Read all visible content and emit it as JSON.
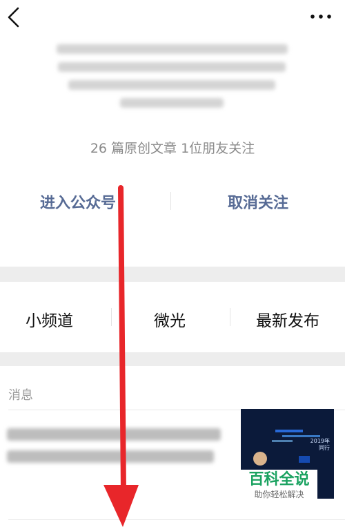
{
  "header": {
    "back_icon": "chevron-left-icon",
    "more_icon": "more-dots-icon"
  },
  "profile": {
    "stats": "26 篇原创文章 1位朋友关注"
  },
  "actions": {
    "enter": "进入公众号",
    "unfollow": "取消关注",
    "accent_color": "#576b95"
  },
  "tabs": [
    {
      "label": "小频道"
    },
    {
      "label": "微光"
    },
    {
      "label": "最新发布"
    }
  ],
  "messages": {
    "section_label": "消息",
    "thumbnail_caption": "2019年\n同行"
  },
  "watermark": {
    "title": "百科全说",
    "subtitle": "助你轻松解决",
    "color": "#1aa260"
  },
  "annotation": {
    "arrow_color": "#e8262a"
  }
}
